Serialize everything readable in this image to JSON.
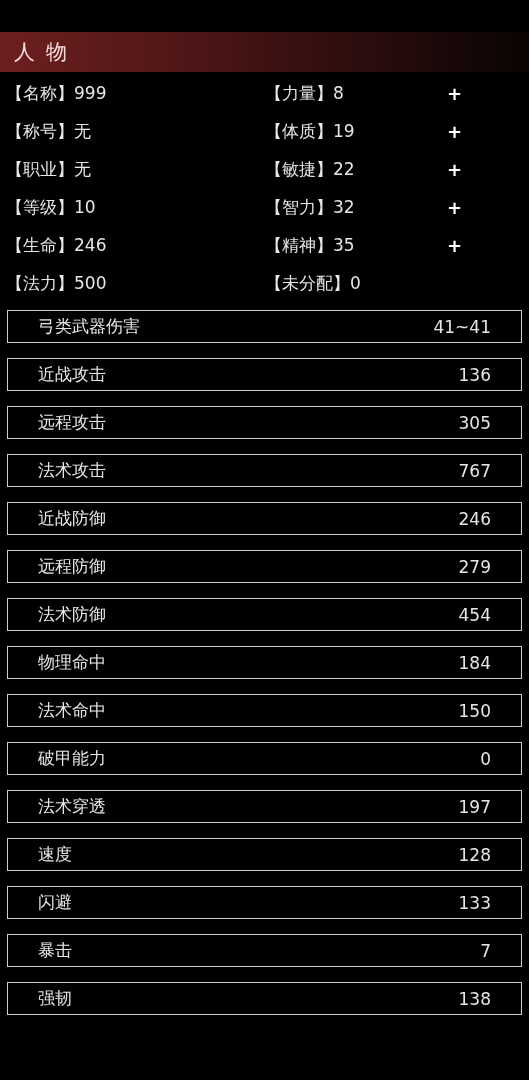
{
  "header": {
    "title": "人 物"
  },
  "info_rows": [
    {
      "left": {
        "label": "【名称】",
        "value": "999"
      },
      "right": {
        "label": "【力量】",
        "value": "8",
        "button": "+"
      }
    },
    {
      "left": {
        "label": "【称号】",
        "value": "无"
      },
      "right": {
        "label": "【体质】",
        "value": "19",
        "button": "+"
      }
    },
    {
      "left": {
        "label": "【职业】",
        "value": "无"
      },
      "right": {
        "label": "【敏捷】",
        "value": "22",
        "button": "+"
      }
    },
    {
      "left": {
        "label": "【等级】",
        "value": "10"
      },
      "right": {
        "label": "【智力】",
        "value": "32",
        "button": "+"
      }
    },
    {
      "left": {
        "label": "【生命】",
        "value": "246"
      },
      "right": {
        "label": "【精神】",
        "value": "35",
        "button": "+"
      }
    },
    {
      "left": {
        "label": "【法力】",
        "value": "500"
      },
      "right": {
        "label": "【未分配】",
        "value": "0"
      }
    }
  ],
  "stats": [
    {
      "label": "弓类武器伤害",
      "value": "41~41"
    },
    {
      "label": "近战攻击",
      "value": "136"
    },
    {
      "label": "远程攻击",
      "value": "305"
    },
    {
      "label": "法术攻击",
      "value": "767"
    },
    {
      "label": "近战防御",
      "value": "246"
    },
    {
      "label": "远程防御",
      "value": "279"
    },
    {
      "label": "法术防御",
      "value": "454"
    },
    {
      "label": "物理命中",
      "value": "184"
    },
    {
      "label": "法术命中",
      "value": "150"
    },
    {
      "label": "破甲能力",
      "value": "0"
    },
    {
      "label": "法术穿透",
      "value": "197"
    },
    {
      "label": "速度",
      "value": "128"
    },
    {
      "label": "闪避",
      "value": "133"
    },
    {
      "label": "暴击",
      "value": "7"
    },
    {
      "label": "强韧",
      "value": "138"
    }
  ]
}
